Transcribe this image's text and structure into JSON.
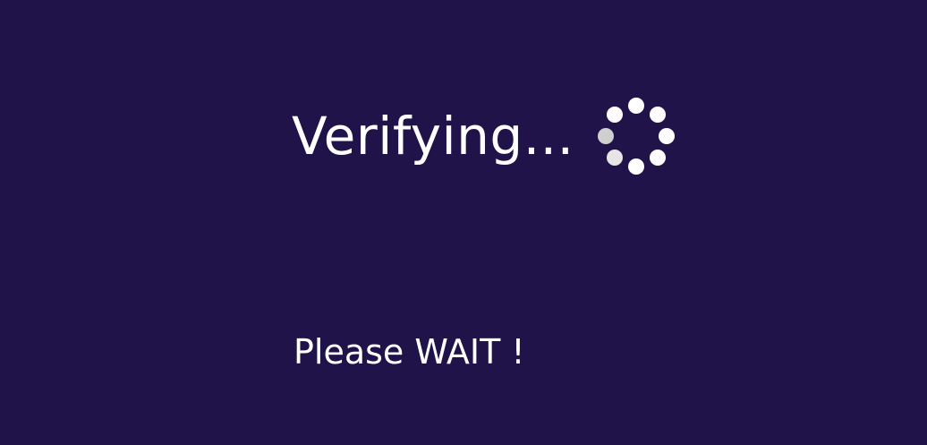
{
  "screen": {
    "background": "#201349"
  },
  "verify": {
    "title": "Verifying...",
    "spinner": {
      "icon": "loading-spinner-icon",
      "dots": [
        {
          "angle": 0,
          "color": "#ffffff"
        },
        {
          "angle": 45,
          "color": "#ffffff"
        },
        {
          "angle": 90,
          "color": "#ffffff"
        },
        {
          "angle": 135,
          "color": "#ffffff"
        },
        {
          "angle": 180,
          "color": "#ffffff"
        },
        {
          "angle": 225,
          "color": "#e6e6e6"
        },
        {
          "angle": 270,
          "color": "#cfcfcf"
        },
        {
          "angle": 315,
          "color": "#ffffff"
        }
      ]
    }
  },
  "wait": {
    "text": "Please WAIT !"
  }
}
